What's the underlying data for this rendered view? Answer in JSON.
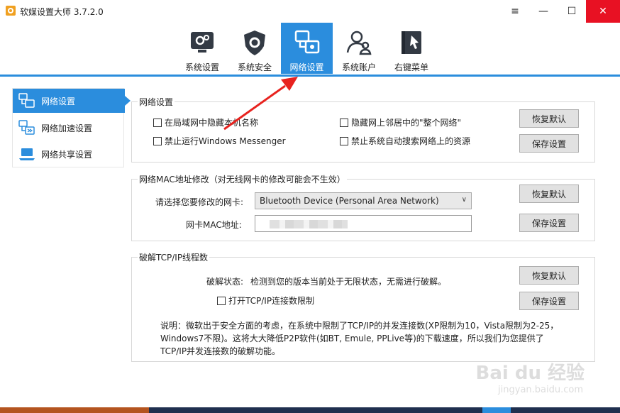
{
  "window": {
    "title": "软媒设置大师 3.7.2.0",
    "controls": {
      "menu": "≡",
      "minimize": "—",
      "maximize": "☐",
      "close": "✕"
    }
  },
  "toolbar": {
    "items": [
      {
        "label": "系统设置",
        "icon": "system-settings-icon"
      },
      {
        "label": "系统安全",
        "icon": "shield-icon"
      },
      {
        "label": "网络设置",
        "icon": "network-icon",
        "active": true
      },
      {
        "label": "系统账户",
        "icon": "users-icon"
      },
      {
        "label": "右键菜单",
        "icon": "context-menu-icon"
      }
    ]
  },
  "sidebar": {
    "items": [
      {
        "label": "网络设置",
        "icon": "network-icon",
        "active": true
      },
      {
        "label": "网络加速设置",
        "icon": "network-speed-icon"
      },
      {
        "label": "网络共享设置",
        "icon": "laptop-share-icon"
      }
    ]
  },
  "net": {
    "title": "网络设置",
    "options": [
      "在局域网中隐藏本机名称",
      "禁止运行Windows Messenger",
      "隐藏网上邻居中的\"整个网络\"",
      "禁止系统自动搜索网络上的资源"
    ],
    "restore": "恢复默认",
    "save": "保存设置"
  },
  "mac": {
    "title": "网络MAC地址修改（对无线网卡的修改可能会不生效）",
    "nic_label": "请选择您要修改的网卡:",
    "nic_value": "Bluetooth Device (Personal Area Network)",
    "mac_label": "网卡MAC地址:",
    "restore": "恢复默认",
    "save": "保存设置"
  },
  "tcp": {
    "title": "破解TCP/IP线程数",
    "status_label": "破解状态:",
    "status_value": "检测到您的版本当前处于无限状态，无需进行破解。",
    "toggle": "打开TCP/IP连接数限制",
    "restore": "恢复默认",
    "save": "保存设置",
    "note": "说明：微软出于安全方面的考虑，在系统中限制了TCP/IP的并发连接数(XP限制为10，Vista限制为2-25，Windows7不限)。这将大大降低P2P软件(如BT, Emule, PPLive等)的下载速度，所以我们为您提供了TCP/IP并发连接数的破解功能。"
  },
  "watermark": {
    "main": "Bai du 经验",
    "sub": "jingyan.baidu.com"
  },
  "colors": {
    "accent": "#2b8ddd",
    "arrow": "#e8231f"
  }
}
